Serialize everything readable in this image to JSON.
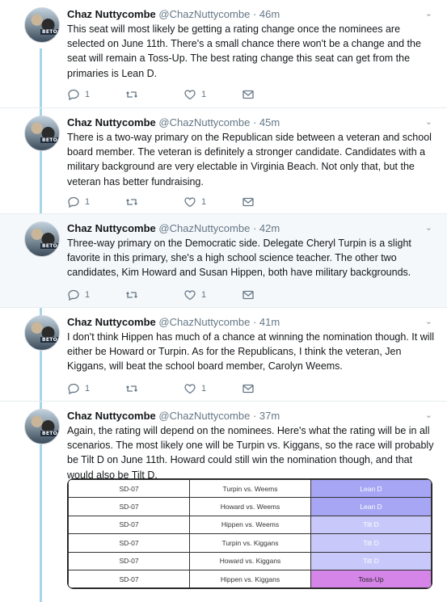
{
  "tweets": [
    {
      "name": "Chaz Nuttycombe",
      "handle": "@ChazNuttycombe",
      "time": "46m",
      "text": "This seat will most likely be getting a rating change once the nominees are selected on June 11th. There's a small chance there won't be a change and the seat will remain a Toss-Up. The best rating change this seat can get from the primaries is Lean D.",
      "replies": "1",
      "retweets": "",
      "likes": "1"
    },
    {
      "name": "Chaz Nuttycombe",
      "handle": "@ChazNuttycombe",
      "time": "45m",
      "text": "There is a two-way primary on the Republican side between a veteran and school board member. The veteran is definitely a stronger candidate. Candidates with a military background are very electable in Virginia Beach. Not only that, but the veteran has better fundraising.",
      "replies": "1",
      "retweets": "",
      "likes": "1"
    },
    {
      "name": "Chaz Nuttycombe",
      "handle": "@ChazNuttycombe",
      "time": "42m",
      "text": "Three-way primary on the Democratic side. Delegate Cheryl Turpin is a slight favorite in this primary, she's a high school science teacher. The other two candidates, Kim Howard and Susan Hippen, both have military backgrounds.",
      "replies": "1",
      "retweets": "",
      "likes": "1"
    },
    {
      "name": "Chaz Nuttycombe",
      "handle": "@ChazNuttycombe",
      "time": "41m",
      "text": "I don't think Hippen has much of a chance at winning the nomination though. It will either be Howard or Turpin. As for the Republicans, I think the veteran, Jen Kiggans, will beat the school board member, Carolyn Weems.",
      "replies": "1",
      "retweets": "",
      "likes": "1"
    },
    {
      "name": "Chaz Nuttycombe",
      "handle": "@ChazNuttycombe",
      "time": "37m",
      "text": "Again, the rating will depend on the nominees. Here's what the rating will be in all scenarios. The most likely one will be Turpin vs. Kiggans, so the race will probably be Tilt D on June 11th. Howard could still win the nomination though, and that would also be Tilt D."
    }
  ],
  "avatar_badge": "BETO",
  "ratings_table": {
    "rows": [
      {
        "district": "SD-07",
        "matchup": "Turpin vs. Weems",
        "rating": "Lean D",
        "color": "#a6a6f4"
      },
      {
        "district": "SD-07",
        "matchup": "Howard vs. Weems",
        "rating": "Lean D",
        "color": "#a6a6f4"
      },
      {
        "district": "SD-07",
        "matchup": "Hippen vs. Weems",
        "rating": "Tilt D",
        "color": "#c8c8fa"
      },
      {
        "district": "SD-07",
        "matchup": "Turpin vs. Kiggans",
        "rating": "Tilt D",
        "color": "#c8c8fa"
      },
      {
        "district": "SD-07",
        "matchup": "Howard vs. Kiggans",
        "rating": "Tilt D",
        "color": "#c8c8fa"
      },
      {
        "district": "SD-07",
        "matchup": "Hippen vs. Kiggans",
        "rating": "Toss-Up",
        "color": "#d585e8"
      }
    ]
  },
  "colors": {
    "thread_line": "#a8d4e8",
    "highlight_bg": "#f5f8fa",
    "muted": "#657786"
  }
}
